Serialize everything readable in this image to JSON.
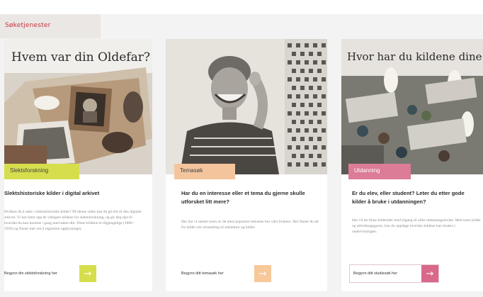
{
  "header": {
    "section_label": "Søketjenester"
  },
  "cards": [
    {
      "headline": "Hvem var din Oldefar?",
      "tag": "Slektsforskning",
      "title": "Slektshistoriske kilder i digital arkivet",
      "body": "Hvilken du å søke i slektshistoriske kilder? På denne siden kan du gå rett til den digitale arkivet. Vi har listet opp de viktigste kildene for slektsforskning, og gir deg tips til hvordan du kan komme i gang med søket ditt. Disse kildene er tilgjengelige (1800 - 1950) og finner mer om å registrere opplysninger.",
      "cta_text": "Begynn din slektsforskning her",
      "cta_icon": "arrow-right-icon",
      "accent": "#d7de4d"
    },
    {
      "headline": "",
      "tag": "Temasøk",
      "title": "Har du en interesse eller et tema du gjerne skulle utforsket litt mere?",
      "body": "Her har vi samlet noen av de mest populære temaene hos våre brukere. Her finner du alt fra kilder om utvandring til arkitektur og bilder.",
      "cta_text": "Begynn ditt temasøk her",
      "cta_icon": "arrow-right-icon",
      "accent": "#f4c59c"
    },
    {
      "headline": "Hvor har du kildene dine fra?",
      "tag": "Utdanning",
      "title": "Er du elev, eller student? Leter du etter gode kilder å bruke i utdanningen?",
      "body": "Her vil du finne kildesider med tilgang til ulike utdanningsnivåer. Med noen kilder og arbeidsoppgaver, kan du oppdage hvordan kildene kan brukes i undervisningen.",
      "cta_text": "Begynn ditt studiesøk her",
      "cta_icon": "arrow-right-icon",
      "accent": "#d9688a"
    }
  ]
}
